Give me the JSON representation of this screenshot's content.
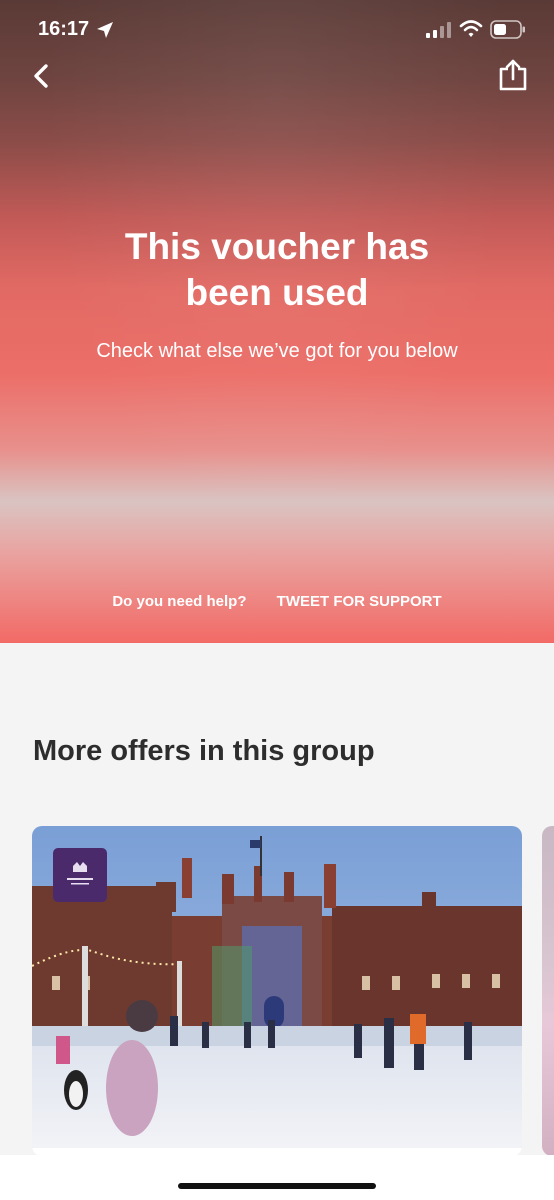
{
  "status_bar": {
    "time": "16:17",
    "icons": [
      "location-arrow-icon",
      "signal-icon",
      "wifi-icon",
      "battery-icon"
    ]
  },
  "nav": {
    "back_icon": "chevron-left-icon",
    "share_icon": "share-icon"
  },
  "voucher": {
    "title_line1": "This voucher has",
    "title_line2": "been used",
    "subtitle": "Check what else we’ve got for you below"
  },
  "help": {
    "question": "Do you need help?",
    "tweet_label": "TWEET FOR SUPPORT"
  },
  "offers": {
    "heading": "More offers in this group",
    "cards": [
      {
        "image": "ice-skating-palace-photo",
        "logo": "hampton-court-palace-logo"
      }
    ]
  },
  "colors": {
    "hero_top": "#5a3a36",
    "hero_mid": "#ec6e68",
    "hero_bottom": "#f26a66",
    "page_background": "#f4f4f4",
    "heading_text": "#2d2d2d",
    "logo_purple": "#4a2a6a"
  }
}
